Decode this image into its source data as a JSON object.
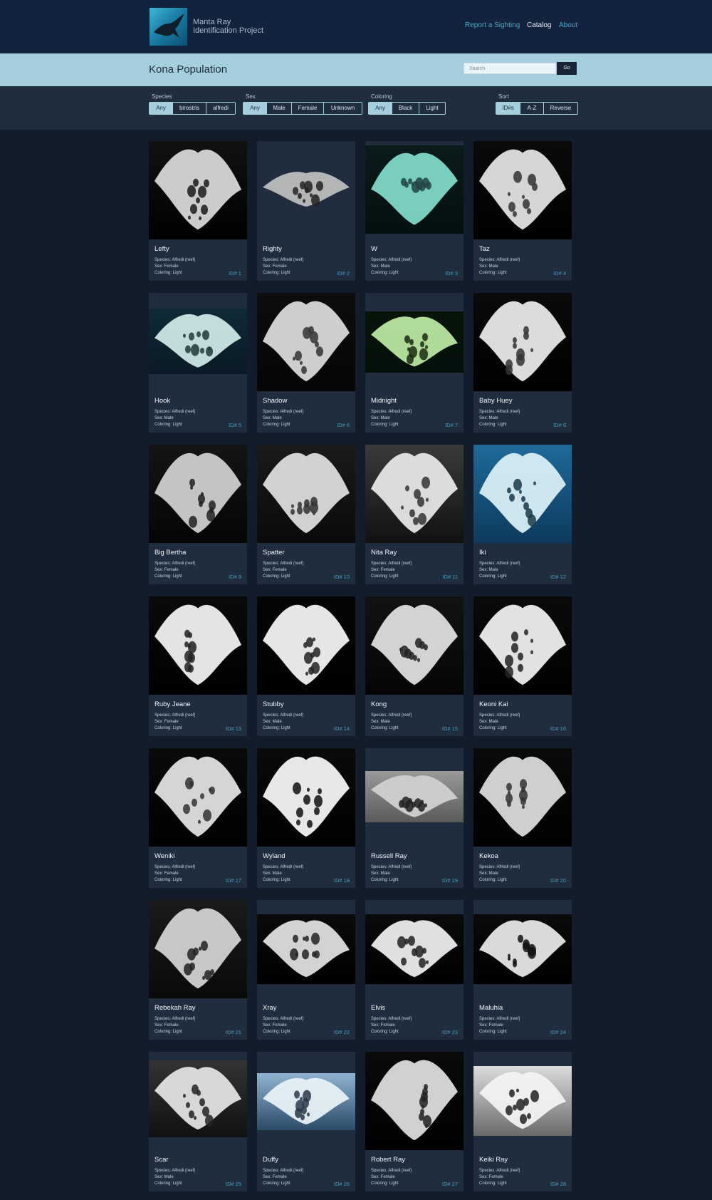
{
  "header": {
    "brand_line1": "Manta Ray",
    "brand_line2": "Identification Project",
    "nav": {
      "report": "Report a Sighting",
      "catalog": "Catalog",
      "about": "About"
    }
  },
  "title_bar": {
    "title": "Kona Population",
    "search_placeholder": "Search",
    "go_label": "Go"
  },
  "filters": {
    "species": {
      "label": "Species",
      "options": [
        "Any",
        "birostris",
        "alfredi"
      ],
      "selected": "Any"
    },
    "sex": {
      "label": "Sex",
      "options": [
        "Any",
        "Male",
        "Female",
        "Unknown"
      ],
      "selected": "Any"
    },
    "coloring": {
      "label": "Coloring",
      "options": [
        "Any",
        "Black",
        "Light"
      ],
      "selected": "Any"
    },
    "sort": {
      "label": "Sort",
      "options": [
        "ID#s",
        "A-Z",
        "Reverse"
      ],
      "selected": "ID#s"
    }
  },
  "colors": {
    "accent": "#a6cfde",
    "id_text": "#3f9ec2",
    "nav_link": "#4aa8c8",
    "card_bg": "#202d3f",
    "page_bg": "#121c2b"
  },
  "mantas": [
    {
      "name": "Lefty",
      "species": "Species: Alfredi (reef)",
      "sex": "Sex: Female",
      "coloring": "Coloring: Light",
      "id": "ID# 1"
    },
    {
      "name": "Righty",
      "species": "Species: Alfredi (reef)",
      "sex": "Sex: Female",
      "coloring": "Coloring: Light",
      "id": "ID# 2"
    },
    {
      "name": "W",
      "species": "Species: Alfredi (reef)",
      "sex": "Sex: Male",
      "coloring": "Coloring: Light",
      "id": "ID# 3"
    },
    {
      "name": "Taz",
      "species": "Species: Alfredi (reef)",
      "sex": "Sex: Male",
      "coloring": "Coloring: Light",
      "id": "ID# 4"
    },
    {
      "name": "Hook",
      "species": "Species: Alfredi (reef)",
      "sex": "Sex: Male",
      "coloring": "Coloring: Light",
      "id": "ID# 5"
    },
    {
      "name": "Shadow",
      "species": "Species: Alfredi (reef)",
      "sex": "Sex: Male",
      "coloring": "Coloring: Light",
      "id": "ID# 6"
    },
    {
      "name": "Midnight",
      "species": "Species: Alfredi (reef)",
      "sex": "Sex: Male",
      "coloring": "Coloring: Light",
      "id": "ID# 7"
    },
    {
      "name": "Baby Huey",
      "species": "Species: Alfredi (reef)",
      "sex": "Sex: Male",
      "coloring": "Coloring: Light",
      "id": "ID# 8"
    },
    {
      "name": "Big Bertha",
      "species": "Species: Alfredi (reef)",
      "sex": "Sex: Female",
      "coloring": "Coloring: Light",
      "id": "ID# 9"
    },
    {
      "name": "Spatter",
      "species": "Species: Alfredi (reef)",
      "sex": "Sex: Female",
      "coloring": "Coloring: Light",
      "id": "ID# 10"
    },
    {
      "name": "Nita Ray",
      "species": "Species: Alfredi (reef)",
      "sex": "Sex: Female",
      "coloring": "Coloring: Light",
      "id": "ID# 11"
    },
    {
      "name": "Iki",
      "species": "Species: Alfredi (reef)",
      "sex": "Sex: Male",
      "coloring": "Coloring: Light",
      "id": "ID# 12"
    },
    {
      "name": "Ruby Jeane",
      "species": "Species: Alfredi (reef)",
      "sex": "Sex: Female",
      "coloring": "Coloring: Light",
      "id": "ID# 13"
    },
    {
      "name": "Stubby",
      "species": "Species: Alfredi (reef)",
      "sex": "Sex: Male",
      "coloring": "Coloring: Light",
      "id": "ID# 14"
    },
    {
      "name": "Kong",
      "species": "Species: Alfredi (reef)",
      "sex": "Sex: Male",
      "coloring": "Coloring: Light",
      "id": "ID# 15"
    },
    {
      "name": "Keoni Kai",
      "species": "Species: Alfredi (reef)",
      "sex": "Sex: Male",
      "coloring": "Coloring: Light",
      "id": "ID# 16"
    },
    {
      "name": "Weniki",
      "species": "Species: Alfredi (reef)",
      "sex": "Sex: Female",
      "coloring": "Coloring: Light",
      "id": "ID# 17"
    },
    {
      "name": "Wyland",
      "species": "Species: Alfredi (reef)",
      "sex": "Sex: Male",
      "coloring": "Coloring: Light",
      "id": "ID# 18"
    },
    {
      "name": "Russell Ray",
      "species": "Species: Alfredi (reef)",
      "sex": "Sex: Male",
      "coloring": "Coloring: Light",
      "id": "ID# 19"
    },
    {
      "name": "Kekoa",
      "species": "Species: Alfredi (reef)",
      "sex": "Sex: Male",
      "coloring": "Coloring: Light",
      "id": "ID# 20"
    },
    {
      "name": "Rebekah Ray",
      "species": "Species: Alfredi (reef)",
      "sex": "Sex: Female",
      "coloring": "Coloring: Light",
      "id": "ID# 21"
    },
    {
      "name": "Xray",
      "species": "Species: Alfredi (reef)",
      "sex": "Sex: Female",
      "coloring": "Coloring: Light",
      "id": "ID# 22"
    },
    {
      "name": "Elvis",
      "species": "Species: Alfredi (reef)",
      "sex": "Sex: Female",
      "coloring": "Coloring: Light",
      "id": "ID# 23"
    },
    {
      "name": "Maluhia",
      "species": "Species: Alfredi (reef)",
      "sex": "Sex: Female",
      "coloring": "Coloring: Light",
      "id": "ID# 24"
    },
    {
      "name": "Scar",
      "species": "Species: Alfredi (reef)",
      "sex": "Sex: Male",
      "coloring": "Coloring: Light",
      "id": "ID# 25"
    },
    {
      "name": "Duffy",
      "species": "Species: Alfredi (reef)",
      "sex": "Sex: Female",
      "coloring": "Coloring: Light",
      "id": "ID# 26"
    },
    {
      "name": "Robert Ray",
      "species": "Species: Alfredi (reef)",
      "sex": "Sex: Female",
      "coloring": "Coloring: Light",
      "id": "ID# 27"
    },
    {
      "name": "Keiki Ray",
      "species": "Species: Alfredi (reef)",
      "sex": "Sex: Female",
      "coloring": "Coloring: Light",
      "id": "ID# 28"
    }
  ]
}
